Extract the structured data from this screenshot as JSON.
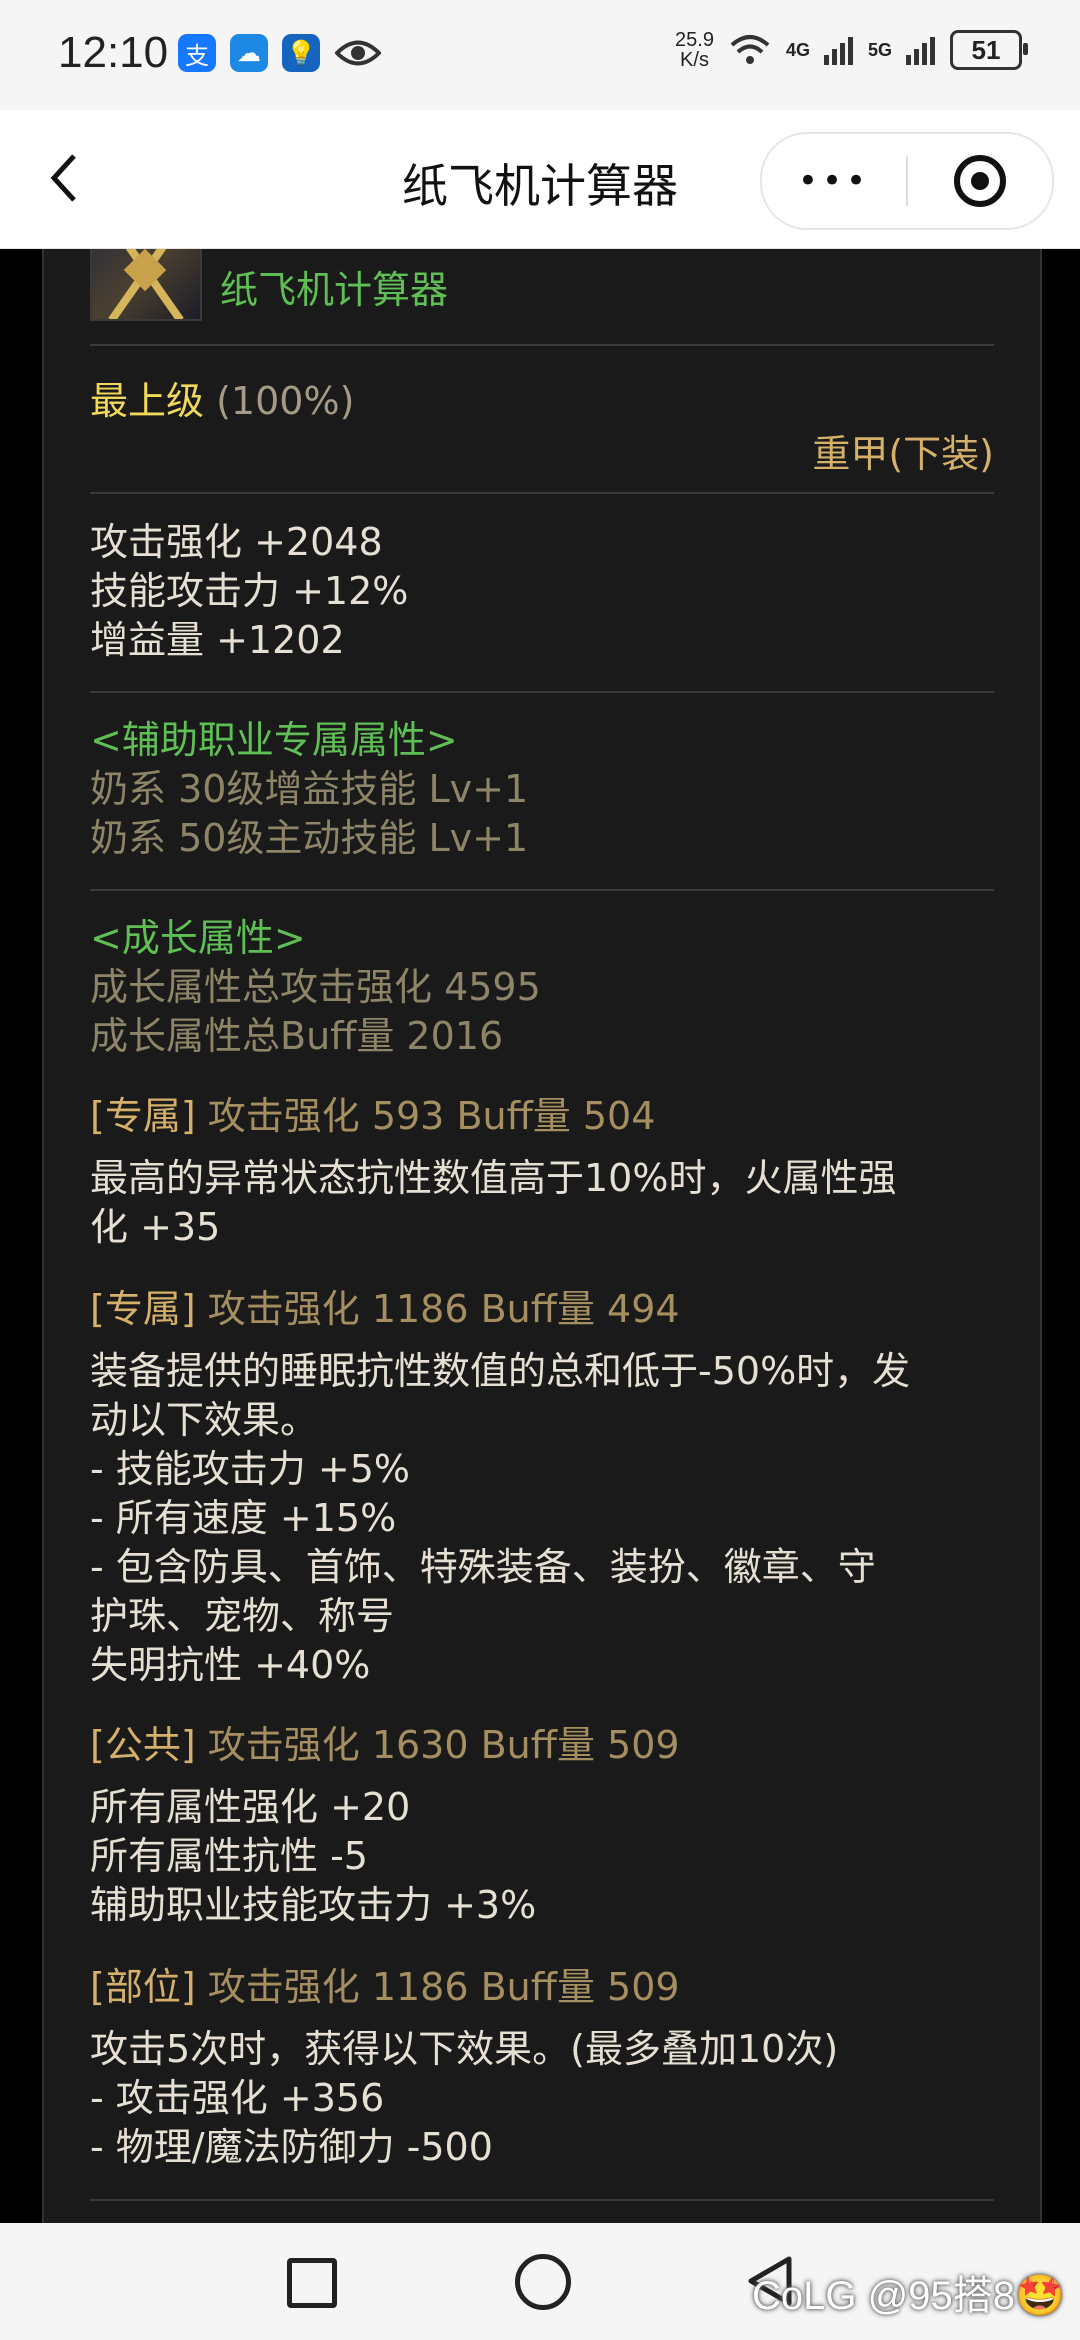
{
  "status_bar": {
    "time": "12:10",
    "speed_value": "25.9",
    "speed_unit": "K/s",
    "net1": "4G",
    "net2": "5G",
    "battery": "51"
  },
  "title_bar": {
    "title": "纸飞机计算器",
    "more_label": "•••"
  },
  "item": {
    "calc_label": "纸飞机计算器",
    "grade": "最上级",
    "grade_percent": "(100%)",
    "type": "重甲(下装)"
  },
  "base_stats": [
    "攻击强化 +2048",
    "技能攻击力 +12%",
    "增益量 +1202"
  ],
  "support": {
    "header": "<辅助职业专属属性>",
    "lines": [
      "奶系 30级增益技能 Lv+1",
      "奶系 50级主动技能 Lv+1"
    ]
  },
  "growth": {
    "header": "<成长属性>",
    "total_attack": "成长属性总攻击强化 4595",
    "total_buff": "成长属性总Buff量 2016",
    "options": [
      {
        "tag": "[专属]",
        "stats": "攻击强化   593    Buff量   504",
        "desc": "最高的异常状态抗性数值高于10%时，火属性强\n化 +35"
      },
      {
        "tag": "[专属]",
        "stats": "攻击强化   1186    Buff量   494",
        "desc": "装备提供的睡眠抗性数值的总和低于-50%时，发\n动以下效果。\n- 技能攻击力 +5%\n- 所有速度 +15%\n- 包含防具、首饰、特殊装备、装扮、徽章、守\n护珠、宠物、称号\n失明抗性 +40%"
      },
      {
        "tag": "[公共]",
        "stats": "攻击强化   1630    Buff量   509",
        "desc": "所有属性强化 +20\n所有属性抗性 -5\n辅助职业技能攻击力 +3%"
      },
      {
        "tag": "[部位]",
        "stats": "攻击强化   1186    Buff量   509",
        "desc": "攻击5次时，获得以下效果。(最多叠加10次)\n- 攻击强化 +356\n- 物理/魔法防御力 -500"
      }
    ]
  },
  "watermark": "CoLG @95搭8🤩"
}
